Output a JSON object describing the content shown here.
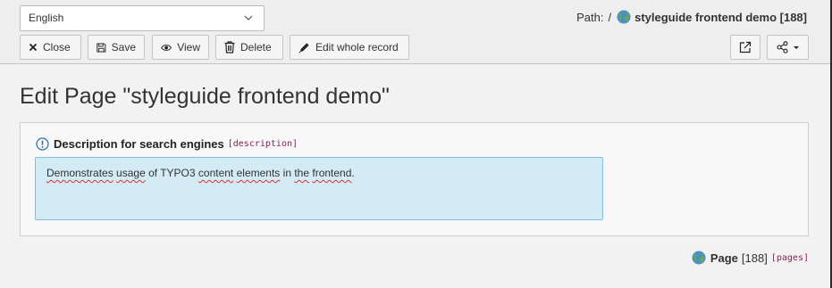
{
  "language_select": {
    "value": "English"
  },
  "path": {
    "label": "Path:",
    "separator": "/",
    "page_title": "styleguide frontend demo",
    "page_id": "[188]"
  },
  "toolbar": {
    "close_label": "Close",
    "save_label": "Save",
    "view_label": "View",
    "delete_label": "Delete",
    "edit_whole_record_label": "Edit whole record"
  },
  "page_heading": "Edit Page \"styleguide frontend demo\"",
  "field": {
    "label": "Description for search engines",
    "column_name": "[description]",
    "value_parts": [
      {
        "text": "Demonstrates",
        "spell": true
      },
      {
        "text": " ",
        "spell": false
      },
      {
        "text": "usage",
        "spell": true
      },
      {
        "text": " of TYPO3 ",
        "spell": false
      },
      {
        "text": "content",
        "spell": true
      },
      {
        "text": " ",
        "spell": false
      },
      {
        "text": "elements",
        "spell": true
      },
      {
        "text": " in ",
        "spell": false
      },
      {
        "text": "the",
        "spell": true
      },
      {
        "text": " ",
        "spell": false
      },
      {
        "text": "frontend",
        "spell": true
      },
      {
        "text": ".",
        "spell": false
      }
    ]
  },
  "record_info": {
    "type": "Page",
    "id": "[188]",
    "table": "[pages]"
  },
  "colors": {
    "accent_field_bg": "#d3ebf5",
    "accent_field_border": "#7fc0df",
    "table_name": "#8b1e5a"
  },
  "icons": [
    "chevron-down-icon",
    "globe-icon",
    "close-icon",
    "save-icon",
    "eye-icon",
    "trash-icon",
    "pencil-icon",
    "external-link-icon",
    "share-icon",
    "info-icon"
  ]
}
